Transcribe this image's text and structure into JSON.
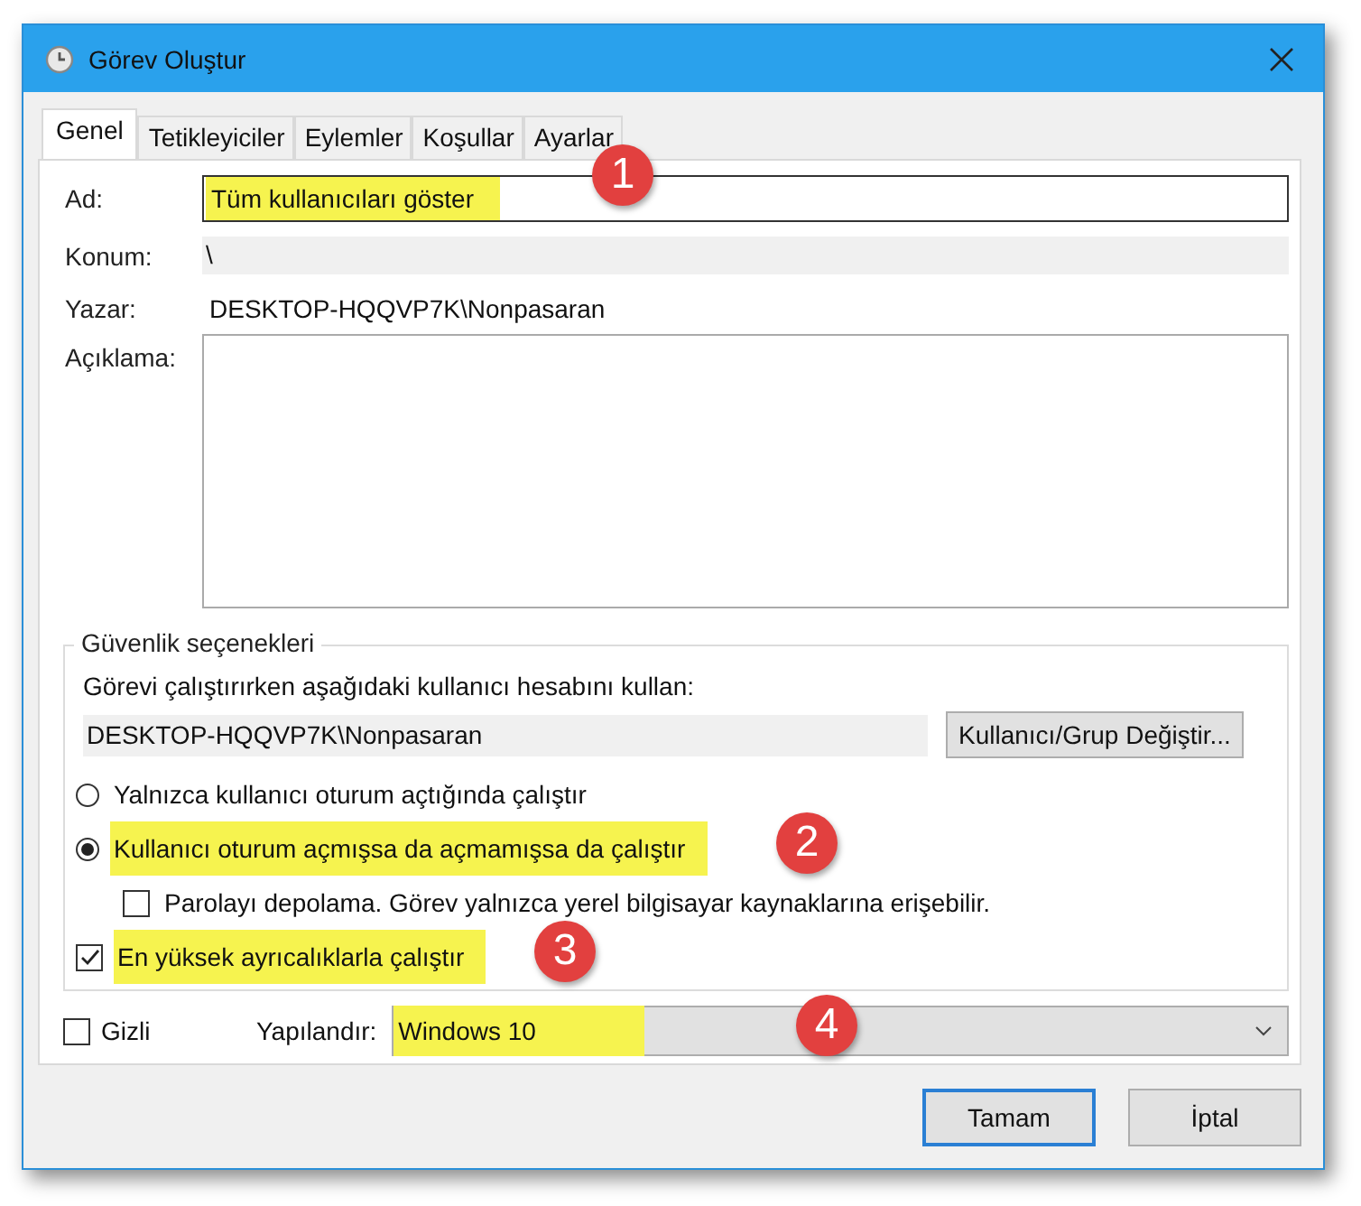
{
  "window": {
    "title": "Görev Oluştur"
  },
  "tabs": [
    {
      "label": "Genel",
      "selected": true
    },
    {
      "label": "Tetikleyiciler",
      "selected": false
    },
    {
      "label": "Eylemler",
      "selected": false
    },
    {
      "label": "Koşullar",
      "selected": false
    },
    {
      "label": "Ayarlar",
      "selected": false
    }
  ],
  "general": {
    "name": {
      "label": "Ad:",
      "value": "Tüm kullanıcıları göster",
      "highlighted": true
    },
    "location": {
      "label": "Konum:",
      "value": "\\"
    },
    "author": {
      "label": "Yazar:",
      "value": "DESKTOP-HQQVP7K\\Nonpasaran"
    },
    "description": {
      "label": "Açıklama:"
    }
  },
  "security": {
    "title": "Güvenlik seçenekleri",
    "prompt": "Görevi çalıştırırken aşağıdaki kullanıcı hesabını kullan:",
    "account": "DESKTOP-HQQVP7K\\Nonpasaran",
    "change_button": "Kullanıcı/Grup Değiştir...",
    "options": [
      {
        "kind": "radio",
        "label": "Yalnızca kullanıcı oturum açtığında çalıştır",
        "selected": false,
        "indented": false,
        "highlighted": false
      },
      {
        "kind": "radio",
        "label": "Kullanıcı oturum açmışsa da açmamışsa da çalıştır",
        "selected": true,
        "indented": false,
        "highlighted": true
      },
      {
        "kind": "checkbox",
        "label": "Parolayı depolama. Görev yalnızca yerel bilgisayar kaynaklarına erişebilir.",
        "checked": false,
        "indented": true,
        "highlighted": false
      },
      {
        "kind": "checkbox",
        "label": "En yüksek ayrıcalıklarla çalıştır",
        "checked": true,
        "indented": false,
        "highlighted": true
      }
    ]
  },
  "hidden": {
    "label": "Gizli",
    "checked": false
  },
  "configure": {
    "label": "Yapılandır:",
    "value": "Windows 10",
    "highlighted": true
  },
  "buttons": [
    {
      "label": "Tamam",
      "default": true
    },
    {
      "label": "İptal",
      "default": false
    }
  ],
  "annotations": [
    {
      "number": "1"
    },
    {
      "number": "2"
    },
    {
      "number": "3"
    },
    {
      "number": "4"
    }
  ]
}
